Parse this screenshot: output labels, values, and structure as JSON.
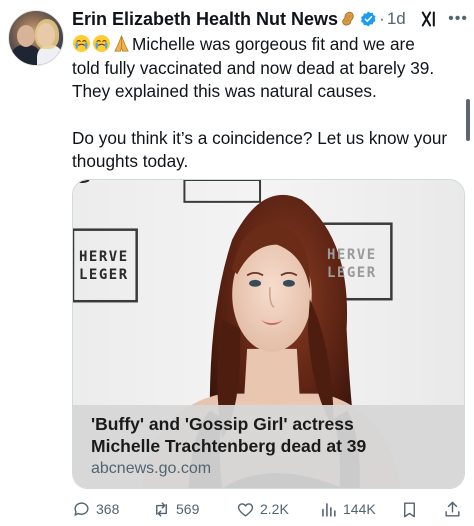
{
  "author": {
    "display_name": "Erin Elizabeth Health Nut News",
    "time": "1d"
  },
  "tweet": {
    "line1": "Michelle was gorgeous fit and we are",
    "line2": "told fully vaccinated and now dead at barely 39.",
    "line3": "They explained this was natural causes.",
    "line4": "Do you think it’s a coincidence? Let us know your",
    "line5": "thoughts today.",
    "emojis": [
      "crying-face-icon",
      "crying-face-icon",
      "folded-hands-icon"
    ]
  },
  "card": {
    "title_line1": "'Buffy' and 'Gossip Girl' actress",
    "title_line2": "Michelle Trachtenberg dead at 39",
    "domain": "abcnews.go.com",
    "backdrop_left_text_1": "HERVE",
    "backdrop_left_text_2": "LEGER",
    "backdrop_right_text_1": "HERVE",
    "backdrop_right_text_2": "LEGER"
  },
  "actions": {
    "replies": "368",
    "retweets": "569",
    "likes": "2.2K",
    "views": "144K"
  },
  "colors": {
    "verified": "#1d9bf0",
    "text_primary": "#0f1419",
    "text_secondary": "#536471",
    "caption_bg": "#d7d7d7"
  }
}
